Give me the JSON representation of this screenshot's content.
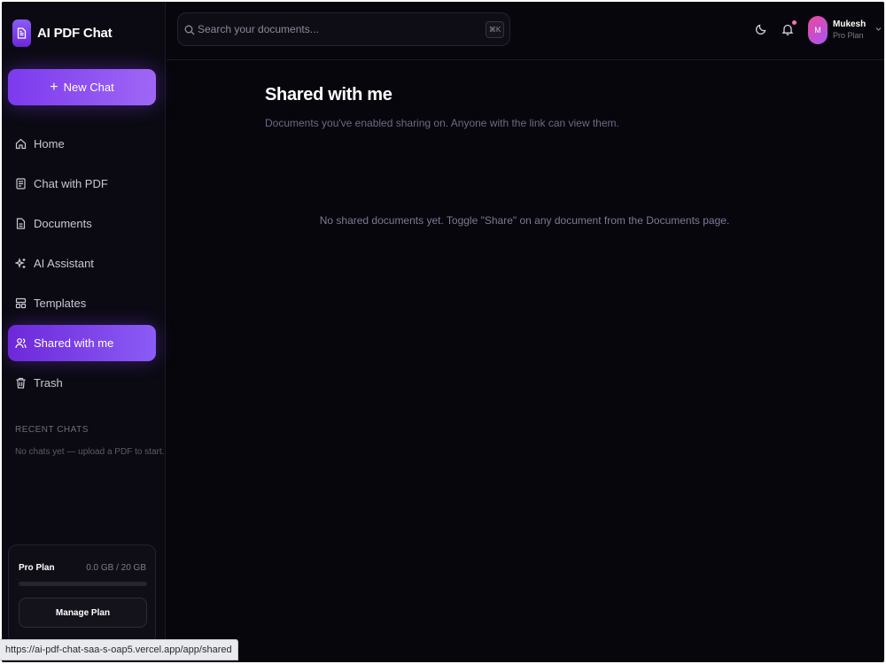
{
  "app": {
    "title": "AI PDF Chat"
  },
  "sidebar": {
    "new_chat_label": "New Chat",
    "items": [
      {
        "label": "Home",
        "icon": "home-icon",
        "active": false
      },
      {
        "label": "Chat with PDF",
        "icon": "file-text-icon",
        "active": false
      },
      {
        "label": "Documents",
        "icon": "document-icon",
        "active": false
      },
      {
        "label": "AI Assistant",
        "icon": "sparkles-icon",
        "active": false
      },
      {
        "label": "Templates",
        "icon": "layout-icon",
        "active": false
      },
      {
        "label": "Shared with me",
        "icon": "users-icon",
        "active": true
      },
      {
        "label": "Trash",
        "icon": "trash-icon",
        "active": false
      }
    ],
    "recent_title": "RECENT CHATS",
    "recent_empty": "No chats yet — upload a PDF to start.",
    "plan": {
      "name": "Pro Plan",
      "usage": "0.0 GB / 20 GB",
      "usage_fraction": 0,
      "button_label": "Manage Plan"
    }
  },
  "header": {
    "search_placeholder": "Search your documents...",
    "shortcut": "⌘K",
    "user": {
      "initial": "M",
      "name": "Mukesh",
      "plan": "Pro Plan"
    },
    "notification_dot_color": "#f472b6"
  },
  "main": {
    "title": "Shared with me",
    "subtitle": "Documents you've enabled sharing on. Anyone with the link can view them.",
    "empty_message": "No shared documents yet. Toggle \"Share\" on any document from the Documents page."
  },
  "status_bar": {
    "url": "https://ai-pdf-chat-saa-s-oap5.vercel.app/app/shared"
  },
  "colors": {
    "accent": "#7c3aed",
    "background": "#07060c",
    "sidebar": "#0b0a12"
  }
}
